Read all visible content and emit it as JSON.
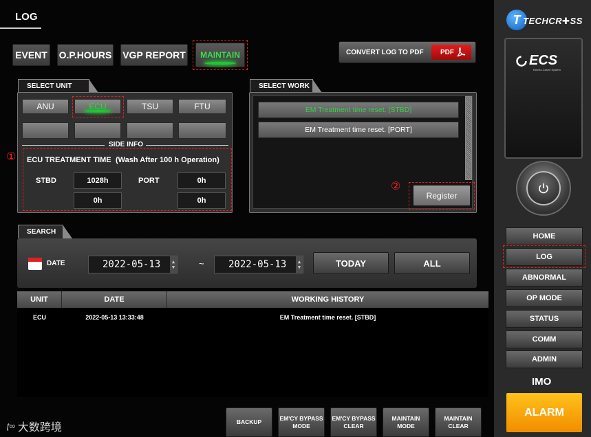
{
  "header": {
    "title": "LOG"
  },
  "tabs": [
    {
      "label": "EVENT"
    },
    {
      "label": "O.P.HOURS"
    },
    {
      "label": "VGP REPORT"
    },
    {
      "label": "MAINTAIN"
    }
  ],
  "convert_pdf": {
    "label": "CONVERT LOG TO PDF",
    "badge": "PDF"
  },
  "select_unit": {
    "title": "SELECT UNIT",
    "units": [
      "ANU",
      "ECU",
      "TSU",
      "FTU"
    ],
    "side_info_label": "SIDE INFO",
    "marker": "①",
    "treatment_title": "ECU TREATMENT TIME",
    "treatment_note": "(Wash After 100 h Operation)",
    "stbd_label": "STBD",
    "port_label": "PORT",
    "stbd_value1": "1028h",
    "stbd_value2": "0h",
    "port_value1": "0h",
    "port_value2": "0h"
  },
  "select_work": {
    "title": "SELECT WORK",
    "items": [
      "EM Treatment time reset. [STBD]",
      "EM Treatment time reset. [PORT]"
    ],
    "marker": "②",
    "register_label": "Register"
  },
  "search": {
    "title": "SEARCH",
    "date_label": "DATE",
    "from": "2022-05-13",
    "separator": "~",
    "to": "2022-05-13",
    "today_label": "TODAY",
    "all_label": "ALL"
  },
  "table": {
    "headers": [
      "UNIT",
      "DATE",
      "WORKING HISTORY"
    ],
    "rows": [
      {
        "unit": "ECU",
        "date": "2022-05-13 13:33:48",
        "history": "EM Treatment time reset. [STBD]"
      }
    ]
  },
  "bottom_buttons": [
    {
      "line1": "BACKUP",
      "line2": ""
    },
    {
      "line1": "EM'CY BYPASS",
      "line2": "MODE"
    },
    {
      "line1": "EM'CY BYPASS",
      "line2": "CLEAR"
    },
    {
      "line1": "MAINTAIN",
      "line2": "MODE"
    },
    {
      "line1": "MAINTAIN",
      "line2": "CLEAR"
    }
  ],
  "watermark": "大数跨境",
  "sidebar": {
    "brand": "TECHCR✚SS",
    "brand_t": "T",
    "ecs_logo": "ECS",
    "ecs_sub": "Electro-Cased System",
    "nav": [
      "HOME",
      "LOG",
      "ABNORMAL",
      "OP MODE",
      "STATUS",
      "COMM",
      "ADMIN"
    ],
    "imo_label": "IMO",
    "alarm_label": "ALARM"
  },
  "colors": {
    "accent_green": "#30dc44",
    "alarm": "#f5a000",
    "annotation_red": "#e02020"
  }
}
